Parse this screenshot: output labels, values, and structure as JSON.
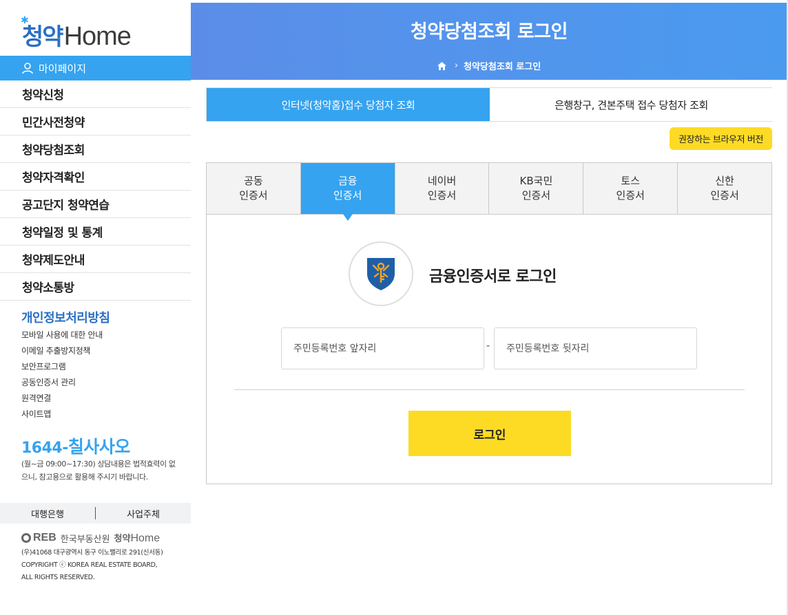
{
  "sidebar": {
    "logo": {
      "korean": "청약",
      "english": "Home"
    },
    "mypage_label": "마이페이지",
    "menu": [
      {
        "label": "청약신청"
      },
      {
        "label": "민간사전청약"
      },
      {
        "label": "청약당첨조회"
      },
      {
        "label": "청약자격확인"
      },
      {
        "label": "공고단지 청약연습"
      },
      {
        "label": "청약일정 및 통계"
      },
      {
        "label": "청약제도안내"
      },
      {
        "label": "청약소통방"
      }
    ],
    "privacy_title": "개인정보처리방침",
    "sub_links": [
      {
        "label": "모바일 사용에 대한 안내"
      },
      {
        "label": "이메일 추출방지정책"
      },
      {
        "label": "보안프로그램"
      },
      {
        "label": "공동인증서 관리"
      },
      {
        "label": "원격연결"
      },
      {
        "label": "사이트맵"
      }
    ],
    "phone": {
      "number": "1644-",
      "word": "칠사사오"
    },
    "phone_note": "(월~금 09:00~17:30) 상담내용은 법적효력이 없으니, 참고용으로 활용해 주시기 바랍니다.",
    "footer_tabs": {
      "left": "대행은행",
      "right": "사업주체"
    },
    "org": {
      "reb": "REB",
      "name": "한국부동산원",
      "home_korean": "청약",
      "home_english": "Home"
    },
    "address_lines": [
      "(우)41068 대구광역시 동구 이노밸리로 291(신서동)",
      "COPYRIGHT ⓒ KOREA REAL ESTATE BOARD,",
      "ALL RIGHTS RESERVED."
    ]
  },
  "header": {
    "title": "청약당첨조회 로그인",
    "breadcrumb": "청약당첨조회 로그인"
  },
  "top_tabs": [
    {
      "label": "인터넷(청약홈)접수 당첨자 조회",
      "active": true
    },
    {
      "label": "은행창구, 견본주택 접수 당첨자 조회",
      "active": false
    }
  ],
  "browser_button": "권장하는 브라우저 버전",
  "cert_tabs": [
    {
      "line1": "공동",
      "line2": "인증서",
      "active": false
    },
    {
      "line1": "금융",
      "line2": "인증서",
      "active": true
    },
    {
      "line1": "네이버",
      "line2": "인증서",
      "active": false
    },
    {
      "line1": "KB국민",
      "line2": "인증서",
      "active": false
    },
    {
      "line1": "토스",
      "line2": "인증서",
      "active": false
    },
    {
      "line1": "신한",
      "line2": "인증서",
      "active": false
    }
  ],
  "login": {
    "heading": "금융인증서로 로그인",
    "id_front_placeholder": "주민등록번호 앞자리",
    "id_back_placeholder": "주민등록번호 뒷자리",
    "separator": "-",
    "button": "로그인"
  },
  "colors": {
    "primary_blue": "#35a3f0",
    "header_gradient_start": "#5b8de8",
    "header_gradient_end": "#4a9bf0",
    "accent_yellow": "#fddb24",
    "brand_navy": "#2b6fc4"
  }
}
